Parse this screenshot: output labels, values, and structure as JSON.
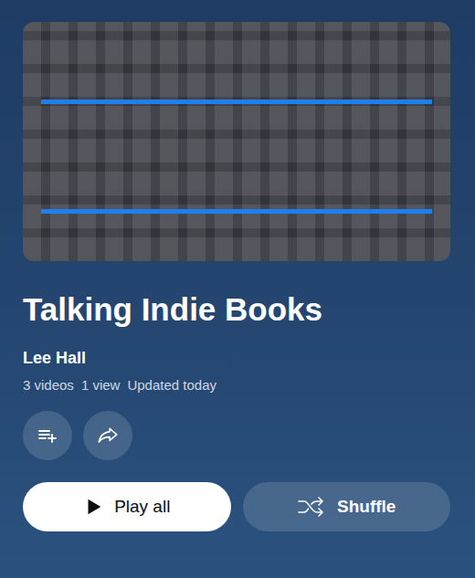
{
  "playlist": {
    "thumbnail": {
      "kind": "video-frame"
    },
    "title": "Talking Indie Books",
    "channel": "Lee Hall",
    "stats": [
      "3 videos",
      "1 view",
      "Updated today"
    ]
  },
  "buttons": [
    {
      "label": "Play all",
      "kind": "play"
    },
    {
      "label": "Shuffle",
      "kind": "shuffle"
    }
  ]
}
